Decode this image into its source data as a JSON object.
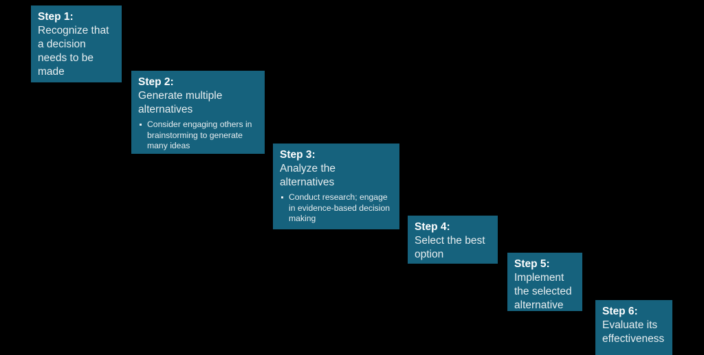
{
  "page": {
    "background_color": "#000000",
    "box_color": "#16627d",
    "title_color": "#ffffff",
    "text_color": "#e8eef0"
  },
  "steps": [
    {
      "title": "Step 1:",
      "description": "Recognize that a decision needs to be made",
      "bullets": []
    },
    {
      "title": "Step 2:",
      "description": "Generate multiple alternatives",
      "bullets": [
        "Consider engaging others in brainstorming to generate many ideas"
      ]
    },
    {
      "title": "Step 3:",
      "description": "Analyze the alternatives",
      "bullets": [
        "Conduct research; engage in evidence-based decision making"
      ]
    },
    {
      "title": "Step 4:",
      "description": "Select the best option",
      "bullets": []
    },
    {
      "title": "Step 5:",
      "description": "Implement the selected alternative",
      "bullets": []
    },
    {
      "title": "Step 6:",
      "description": "Evaluate its effectiveness",
      "bullets": []
    }
  ]
}
